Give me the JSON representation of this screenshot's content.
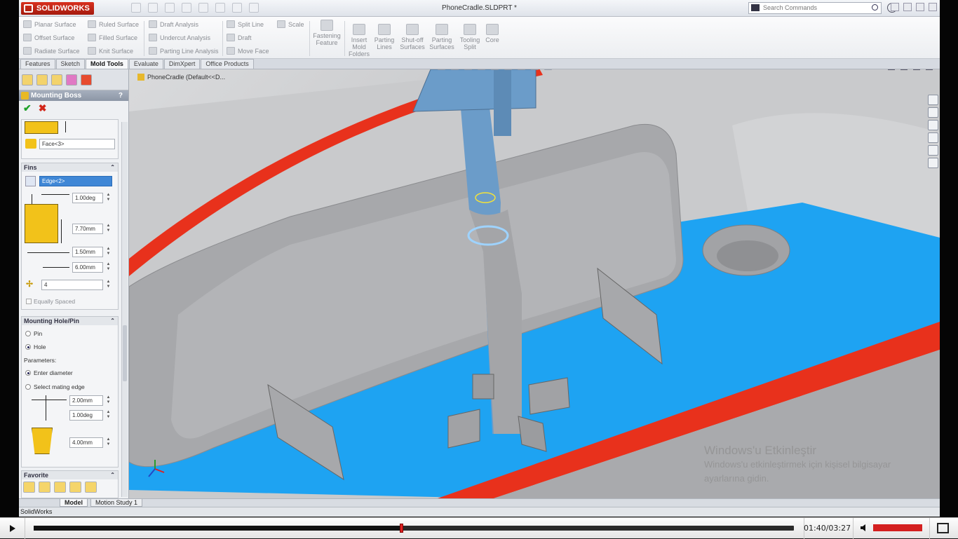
{
  "app": {
    "brand": "SOLIDWORKS",
    "doc_title": "PhoneCradle.SLDPRT *",
    "search_placeholder": "Search Commands"
  },
  "ribbon": {
    "col1": [
      "Planar Surface",
      "Offset Surface",
      "Radiate Surface"
    ],
    "col2": [
      "Ruled Surface",
      "Filled Surface",
      "Knit Surface"
    ],
    "col3": [
      "Draft Analysis",
      "Undercut Analysis",
      "Parting Line Analysis"
    ],
    "col4": [
      "Split Line",
      "Draft",
      "Move Face"
    ],
    "col5": [
      "Scale"
    ],
    "big": [
      "Fastening Feature",
      "Insert Mold Folders",
      "Parting Lines",
      "Shut-off Surfaces",
      "Parting Surfaces",
      "Tooling Split",
      "Core"
    ]
  },
  "tabs": [
    "Features",
    "Sketch",
    "Mold Tools",
    "Evaluate",
    "DimXpert",
    "Office Products"
  ],
  "panel": {
    "title": "Mounting Boss",
    "help": "?",
    "face_field": "Face<3>",
    "fins_title": "Fins",
    "edge_field": "Edge<2>",
    "fin_draft": "1.00deg",
    "fin_height": "7.70mm",
    "fin_width": "1.50mm",
    "fin_length": "6.00mm",
    "fin_count": "4",
    "equally_spaced": "Equally Spaced",
    "hole_title": "Mounting Hole/Pin",
    "pin": "Pin",
    "hole": "Hole",
    "parameters": "Parameters:",
    "enter_diameter": "Enter diameter",
    "select_mating": "Select mating edge",
    "hole_dia": "2.00mm",
    "hole_draft": "1.00deg",
    "hole_depth": "4.00mm",
    "favorite_title": "Favorite"
  },
  "viewport": {
    "breadcrumb": "PhoneCradle  (Default<<D..."
  },
  "bottom_tabs": [
    "Model",
    "Motion Study 1"
  ],
  "status": "SolidWorks",
  "watermark": {
    "line1": "Windows'u Etkinleştir",
    "line2": "Windows'u etkinleştirmek için kişisel bilgisayar",
    "line3": "ayarlarına gidin."
  },
  "player": {
    "current": "01:40",
    "sep": "/",
    "duration": "03:27",
    "progress_fraction": 0.483,
    "volume_fraction": 1.0
  },
  "colors": {
    "accent_red": "#e8311c",
    "accent_blue": "#1ea3f2",
    "boss_blue": "#6b9cc9",
    "selection_blue": "#3f87d6"
  }
}
